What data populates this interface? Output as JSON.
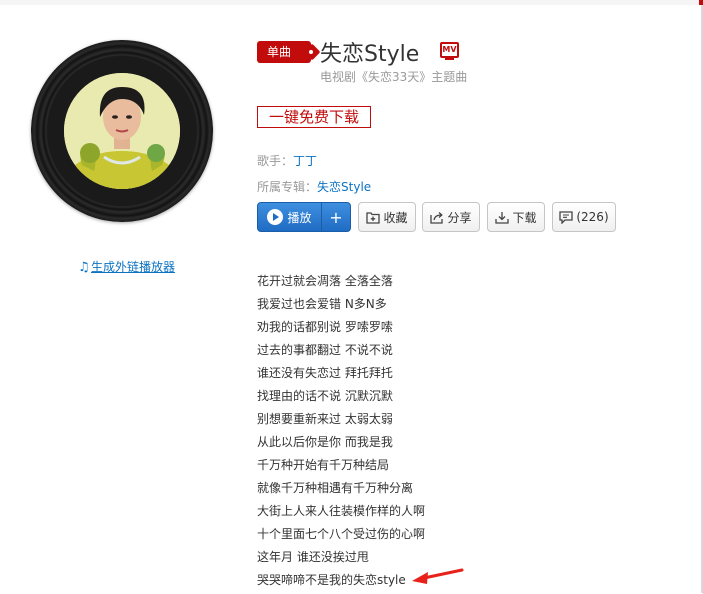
{
  "album_art": {
    "generate_link_label": "生成外链播放器",
    "note_icon": "music-note-icon"
  },
  "song": {
    "badge": "单曲",
    "title": "失恋Style",
    "mv_label": "MV",
    "subtitle": "电视剧《失恋33天》主题曲",
    "free_download": "一键免费下载",
    "singer_label": "歌手：",
    "singer": "丁丁",
    "album_label": "所属专辑：",
    "album": "失恋Style"
  },
  "actions": {
    "play": "播放",
    "add": "+",
    "collect": "收藏",
    "share": "分享",
    "download": "下载",
    "comments": "(226)"
  },
  "lyrics": [
    "花开过就会凋落 全落全落",
    "我爱过也会爱错 N多N多",
    "劝我的话都别说 罗嗦罗嗦",
    "过去的事都翻过 不说不说",
    "谁还没有失恋过 拜托拜托",
    "找理由的话不说 沉默沉默",
    "别想要重新来过 太弱太弱",
    "从此以后你是你 而我是我",
    "千万种开始有千万种结局",
    "就像千万种相遇有千万种分离",
    "大街上人来人往装模作样的人啊",
    "十个里面七个八个受过伤的心啊",
    "这年月 谁还没挨过甩",
    "哭哭啼啼不是我的失恋style"
  ],
  "colors": {
    "brand_red": "#c20c0c",
    "link_blue": "#0c73c2",
    "play_blue": "#1f6cc4"
  }
}
